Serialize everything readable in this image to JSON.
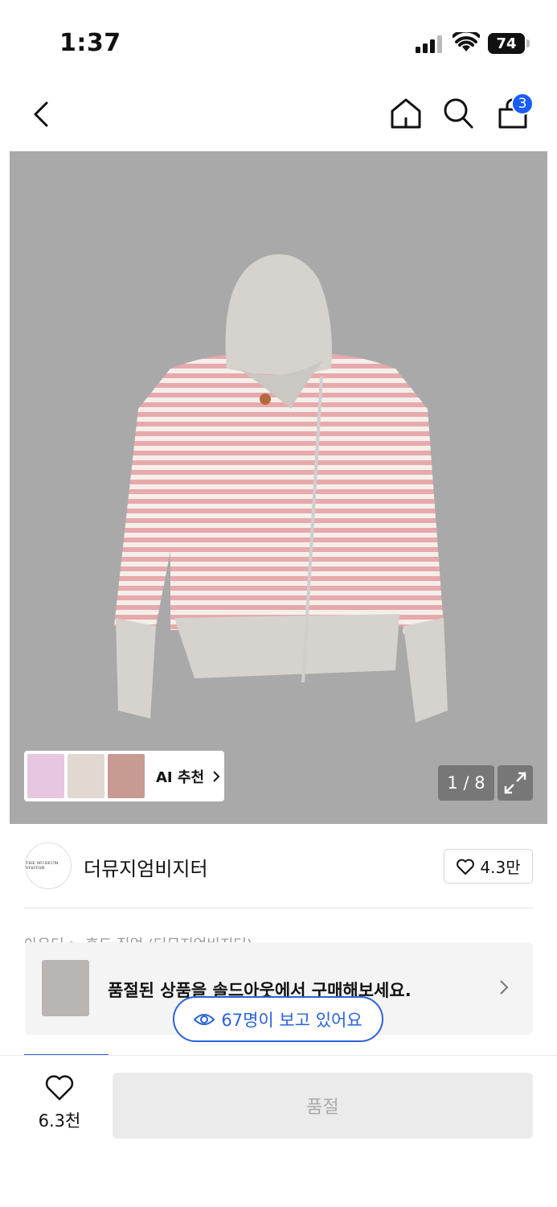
{
  "status_bar": {
    "time": "1:37",
    "battery": "74"
  },
  "nav": {
    "cart_count": "3"
  },
  "gallery": {
    "counter": "1 / 8",
    "ai_label": "AI 추천",
    "background_color": "#a9a9a9"
  },
  "brand": {
    "logo_text": "THE MUSEUM VISITOR",
    "name": "더뮤지엄비지터",
    "likes": "4.3만"
  },
  "obscured_line": "아우터 > 후드 집업 (더뮤지엄비지터)",
  "soldout_banner": {
    "text": "품절된 상품을 솔드아웃에서 구매해보세요."
  },
  "viewers": {
    "text": "67명이 보고 있어요"
  },
  "bottom_bar": {
    "wish_count": "6.3천",
    "buy_label": "품절"
  },
  "colors": {
    "accent": "#2a62d9",
    "badge": "#1a5cff"
  }
}
